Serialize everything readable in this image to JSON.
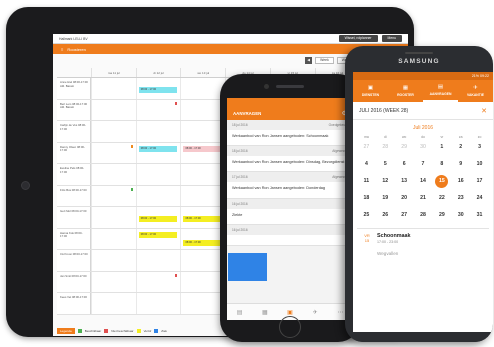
{
  "tablet": {
    "topbar": {
      "left": "Hallmark LELLI BV",
      "user": "Wissel, rolplanner",
      "menu": "Menu"
    },
    "orange_bar": {
      "title": "Roosteren"
    },
    "toolbar": {
      "prev": "◀",
      "next": "▶",
      "range_label": "Week 28 11 juli - 17 juli 2016",
      "view": "Week"
    },
    "days": [
      "ma 11 jul",
      "di 12 jul",
      "wo 13 jul",
      "do 14 jul",
      "vr 15 jul",
      "za 16 jul",
      "zo 17 jul"
    ],
    "rows": [
      {
        "name": "Anne Hiel 08:00-17:00 Afd. Bassin"
      },
      {
        "name": "Bert Lem 08:00-17:00 Afd. Bassin"
      },
      {
        "name": "Carlijn de Vos 08:00-17:00"
      },
      {
        "name": "Danny Olsen 08:00-17:00"
      },
      {
        "name": "Eveline Pels 08:00-17:00"
      },
      {
        "name": "Frits Bos 08:00-17:00"
      },
      {
        "name": "Gert Mol 08:00-17:00"
      },
      {
        "name": "Hanna Kok 08:00-17:00"
      },
      {
        "name": "Iris Kroon 08:00-17:00"
      },
      {
        "name": "Jan Smit 08:00-17:00"
      },
      {
        "name": "Kees Vet 08:00-17:00"
      }
    ],
    "blocks": {
      "r0c1": "08:00 - 17:00",
      "r0c4": "08:00 - 17:00",
      "r1c4": "08:00 - 17:00",
      "r3c1": "08:00 - 17:00",
      "r3c2": "08:00 - 17:00",
      "r3c3": "08:00 - 17:00",
      "r3c4": "08:00 - 17:00",
      "r5c4": "08:00 - 17:00",
      "r6c1": "08:00 - 17:00",
      "r6c2": "08:00 - 17:00",
      "r7c1": "08:00 - 17:00",
      "r7c2": "08:00 - 17:00"
    },
    "legend": {
      "badge": "Legenda",
      "items": [
        "Beschikbaar",
        "Niet beschikbaar",
        "Verlof",
        "Ziek"
      ]
    }
  },
  "iphone": {
    "header_title": "AANVRAGEN",
    "gear_icon": "gear-icon",
    "items": [
      {
        "date": "18 jul 2016",
        "status": "Goedgekeurd",
        "body": "Werkaanbod van Ron Jansen aangeboden: Schoonmaak"
      },
      {
        "date": "18 jul 2016",
        "status": "Afgewezen",
        "body": "Werkaanbod van Ron Jansen aangeboden: Dinsdag, Bezorgdienst"
      },
      {
        "date": "17 jul 2016",
        "status": "Afgewezen",
        "body": "Werkaanbod van Ron Jansen aangeboden: Donderdag"
      },
      {
        "date": "16 jul 2016",
        "status": "",
        "body": "Ziekte"
      },
      {
        "date": "16 jul 2016",
        "status": "",
        "body": ""
      }
    ],
    "tabs": [
      "Diensten",
      "Rooster",
      "Aanvragen",
      "Vakantie",
      "Meer"
    ]
  },
  "samsung": {
    "brand": "SAMSUNG",
    "status_text": "21% 09:22",
    "tabs": [
      {
        "label": "DIENSTEN",
        "icon": "briefcase-icon"
      },
      {
        "label": "ROOSTER",
        "icon": "calendar-icon"
      },
      {
        "label": "AANVRAGEN",
        "icon": "inbox-icon"
      },
      {
        "label": "VAKANTIE",
        "icon": "plane-icon"
      }
    ],
    "week_title": "JULI 2016 (WEEK 28)",
    "close_icon": "close-icon",
    "month_label": "Juli 2016",
    "dow": [
      "ma",
      "di",
      "wo",
      "do",
      "vr",
      "za",
      "zo"
    ],
    "days": [
      {
        "d": "27",
        "m": true
      },
      {
        "d": "28",
        "m": true
      },
      {
        "d": "29",
        "m": true
      },
      {
        "d": "30",
        "m": true
      },
      {
        "d": "1"
      },
      {
        "d": "2"
      },
      {
        "d": "3"
      },
      {
        "d": "4"
      },
      {
        "d": "5"
      },
      {
        "d": "6"
      },
      {
        "d": "7"
      },
      {
        "d": "8"
      },
      {
        "d": "9"
      },
      {
        "d": "10"
      },
      {
        "d": "11"
      },
      {
        "d": "12"
      },
      {
        "d": "13"
      },
      {
        "d": "14"
      },
      {
        "d": "15",
        "sel": true
      },
      {
        "d": "16"
      },
      {
        "d": "17"
      },
      {
        "d": "18"
      },
      {
        "d": "19"
      },
      {
        "d": "20"
      },
      {
        "d": "21"
      },
      {
        "d": "22"
      },
      {
        "d": "23"
      },
      {
        "d": "24"
      },
      {
        "d": "25"
      },
      {
        "d": "26"
      },
      {
        "d": "27"
      },
      {
        "d": "28"
      },
      {
        "d": "29"
      },
      {
        "d": "30"
      },
      {
        "d": "31"
      }
    ],
    "entry": {
      "day": "VR",
      "date": "15",
      "title": "Schoonmaak",
      "time": "17:00 - 23:00"
    },
    "entry2": {
      "title": "Wegvallen"
    }
  },
  "colors": {
    "accent": "#ef7c1c",
    "cyan": "#7fe3ee",
    "pink": "#f6c8cc",
    "yellow": "#f4ee22",
    "blue": "#2f83e6"
  }
}
